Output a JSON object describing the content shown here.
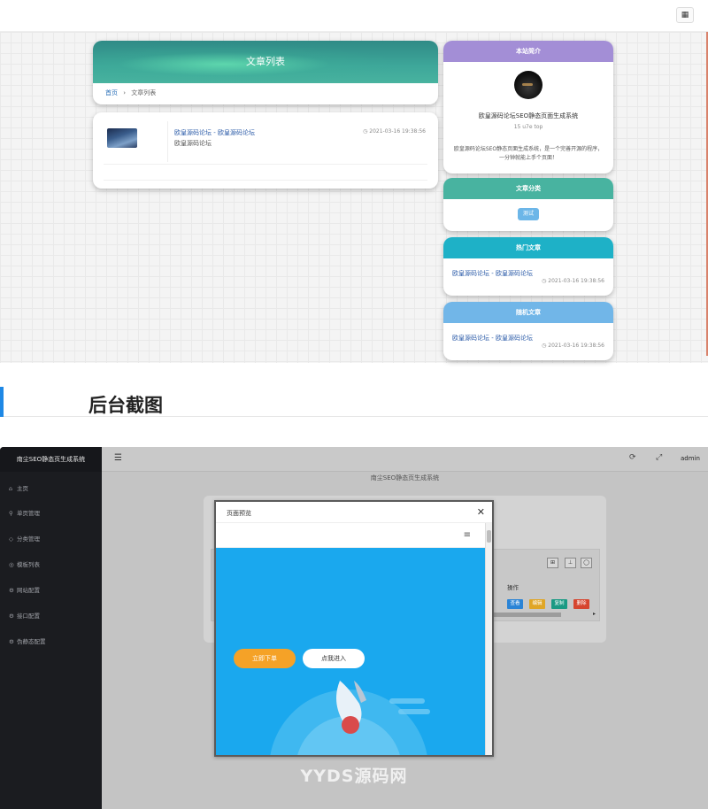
{
  "front": {
    "menu_icon": "grid-menu-icon",
    "article_list": {
      "title": "文章列表",
      "breadcrumb_home": "首页",
      "breadcrumb_sep": "›",
      "breadcrumb_current": "文章列表",
      "item_title": "欧皇源码论坛 - 欧皇源码论坛",
      "item_subtitle": "欧皇源码论坛",
      "item_date": "◷ 2021-03-16 19:38:56"
    },
    "intro": {
      "header": "本站简介",
      "name": "欧皇源码论坛SEO静态页面生成系统",
      "sub": "15 u7e top",
      "desc": "欧皇源码论坛SEO静态页面生成系统，是一个完善开源的程序，一分钟就能上手个页面！"
    },
    "category": {
      "header": "文章分类",
      "tag": "测试"
    },
    "hot": {
      "header": "热门文章",
      "title": "欧皇源码论坛 - 欧皇源码论坛",
      "date": "◷ 2021-03-16 19:38:56"
    },
    "random": {
      "header": "随机文章",
      "title": "欧皇源码论坛 - 欧皇源码论坛",
      "date": "◷ 2021-03-16 19:38:56"
    },
    "colors": {
      "intro": "#a38ed6",
      "category": "#48b3a0",
      "hot": "#1eb1c7",
      "random": "#71b6e8"
    }
  },
  "section": {
    "title": "后台截图"
  },
  "admin": {
    "brand": "南尘SEO静态页生成系统",
    "menu": [
      {
        "icon": "home-icon",
        "glyph": "⌂",
        "label": "主页"
      },
      {
        "icon": "user-icon",
        "glyph": "⚲",
        "label": "单页管理"
      },
      {
        "icon": "tag-icon",
        "glyph": "◇",
        "label": "分类管理"
      },
      {
        "icon": "list-icon",
        "glyph": "◎",
        "label": "模板列表"
      },
      {
        "icon": "gear-icon",
        "glyph": "⚙",
        "label": "网站配置"
      },
      {
        "icon": "settings-icon",
        "glyph": "⚙",
        "label": "接口配置"
      },
      {
        "icon": "tool-icon",
        "glyph": "⚙",
        "label": "伪静态配置"
      }
    ],
    "header_title": "南尘SEO静态页生成系统",
    "user": "admin",
    "operation_label": "操作",
    "row_buttons": [
      {
        "label": "查看",
        "color": "#2b84d6"
      },
      {
        "label": "编辑",
        "color": "#e0a626"
      },
      {
        "label": "复制",
        "color": "#1a9a84"
      },
      {
        "label": "删除",
        "color": "#d6452f"
      }
    ],
    "tool_buttons": [
      "⊞",
      "⊥",
      "◯"
    ],
    "modal": {
      "title": "页面预览",
      "close": "✕",
      "menu_glyph": "≡",
      "btn_primary": "立即下单",
      "btn_secondary": "点我进入"
    }
  },
  "watermark": "YYDS源码网"
}
